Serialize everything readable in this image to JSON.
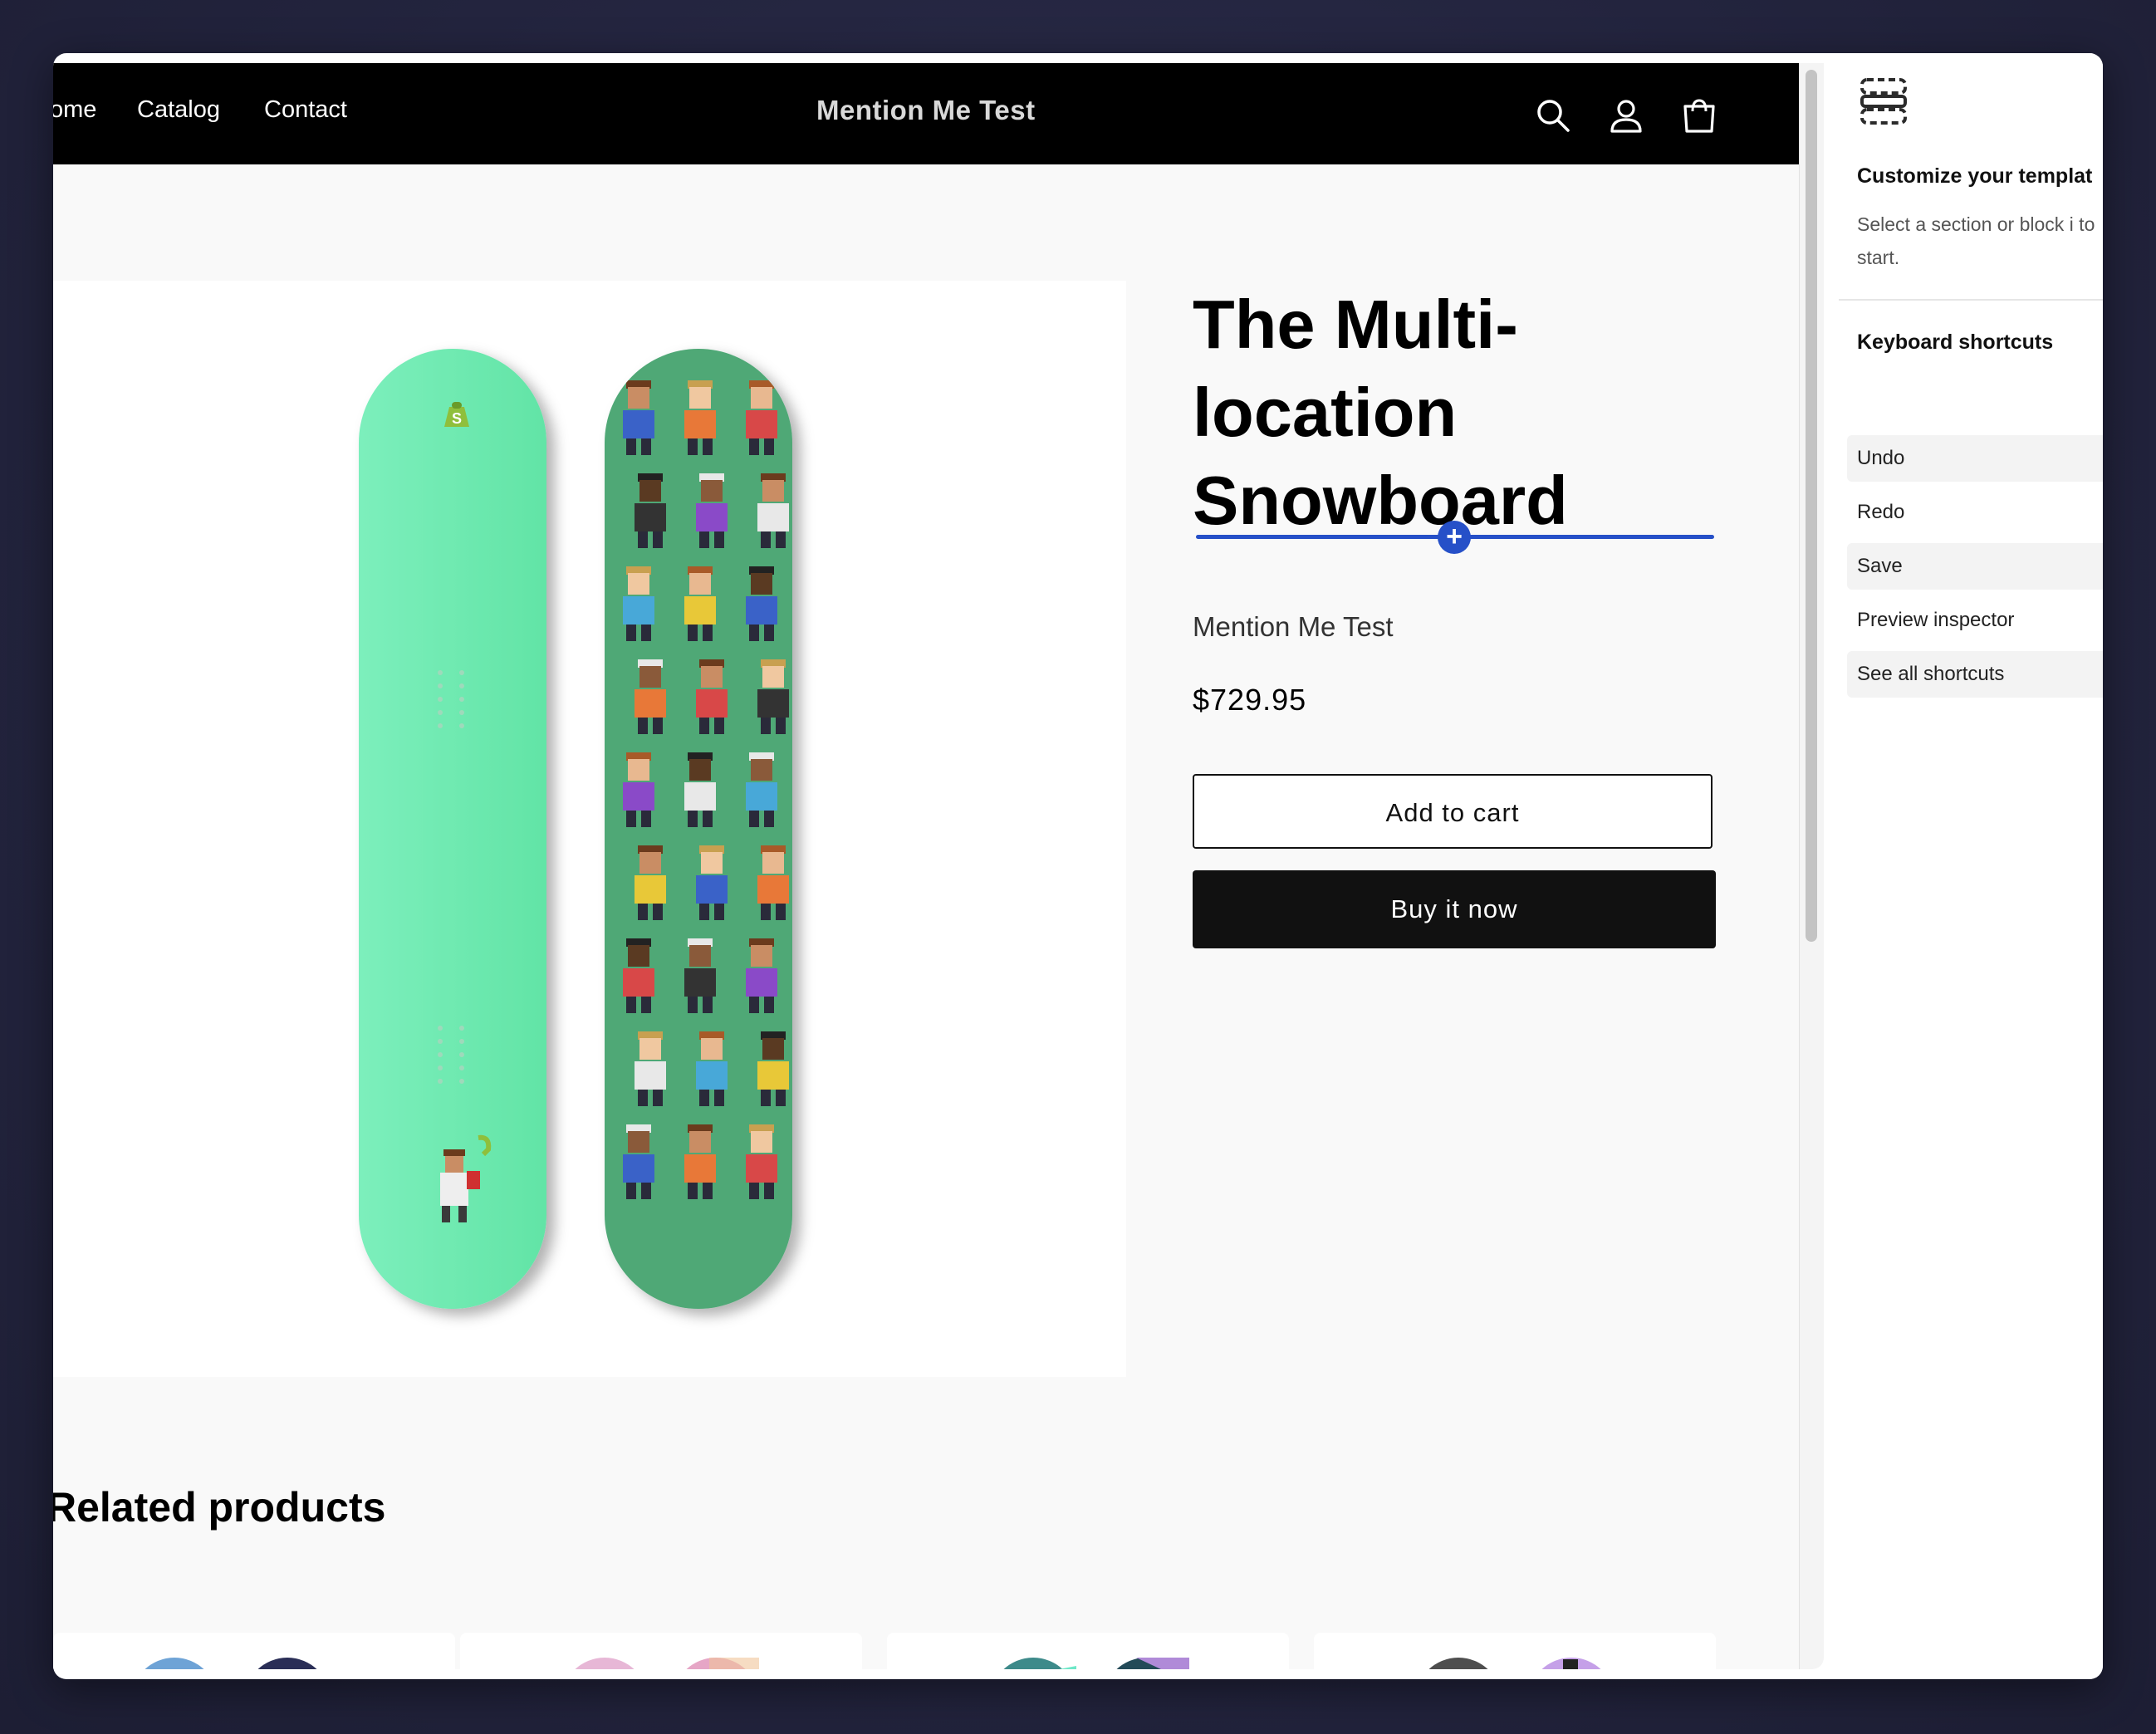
{
  "header": {
    "nav": [
      "ome",
      "Catalog",
      "Contact"
    ],
    "brand": "Mention Me Test",
    "icons": [
      "search-icon",
      "account-icon",
      "cart-icon"
    ]
  },
  "product": {
    "title_lines": [
      "The Multi-",
      "location",
      "Snowboard"
    ],
    "vendor": "Mention Me Test",
    "price": "$729.95",
    "add_to_cart": "Add to cart",
    "buy_now": "Buy it now",
    "insert_symbol": "+"
  },
  "related": {
    "title": "elated products"
  },
  "sidebar": {
    "title": "Customize your templat",
    "description": "Select a section or block i to start.",
    "shortcuts_title": "Keyboard shortcuts",
    "shortcuts": [
      "Undo",
      "Redo",
      "Save",
      "Preview inspector",
      "See all shortcuts"
    ]
  },
  "colors": {
    "accent": "#2650c8",
    "board_light": "#6ee8ae",
    "board_dark": "#4fa876",
    "header_bg": "#000000"
  }
}
